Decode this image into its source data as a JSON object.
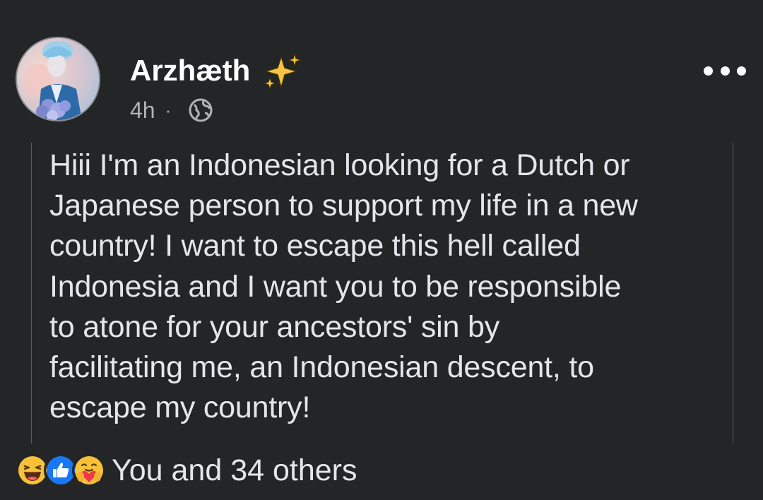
{
  "post": {
    "author": "Arzhæth",
    "author_badge_icon": "sparkles-icon",
    "time": "4h",
    "separator": "·",
    "audience_icon": "globe-icon",
    "more_icon": "more-options-icon",
    "text_lines": [
      "Hiii I'm an Indonesian looking for a Dutch or",
      "Japanese person to support my life in a new",
      "country! I want to escape this hell called",
      "Indonesia and I want you to be responsible",
      "to atone for your ancestors' sin by",
      "facilitating me, an Indonesian descent, to",
      "escape my country!"
    ]
  },
  "reactions": {
    "icons": [
      "haha-reaction-icon",
      "like-reaction-icon",
      "care-reaction-icon"
    ],
    "summary": "You and 34 others"
  },
  "colors": {
    "background": "#242526",
    "text": "#e4e6eb",
    "secondary_text": "#b0b3b8",
    "like_blue": "#1877f2",
    "emoji_yellow": "#f7c13a"
  }
}
